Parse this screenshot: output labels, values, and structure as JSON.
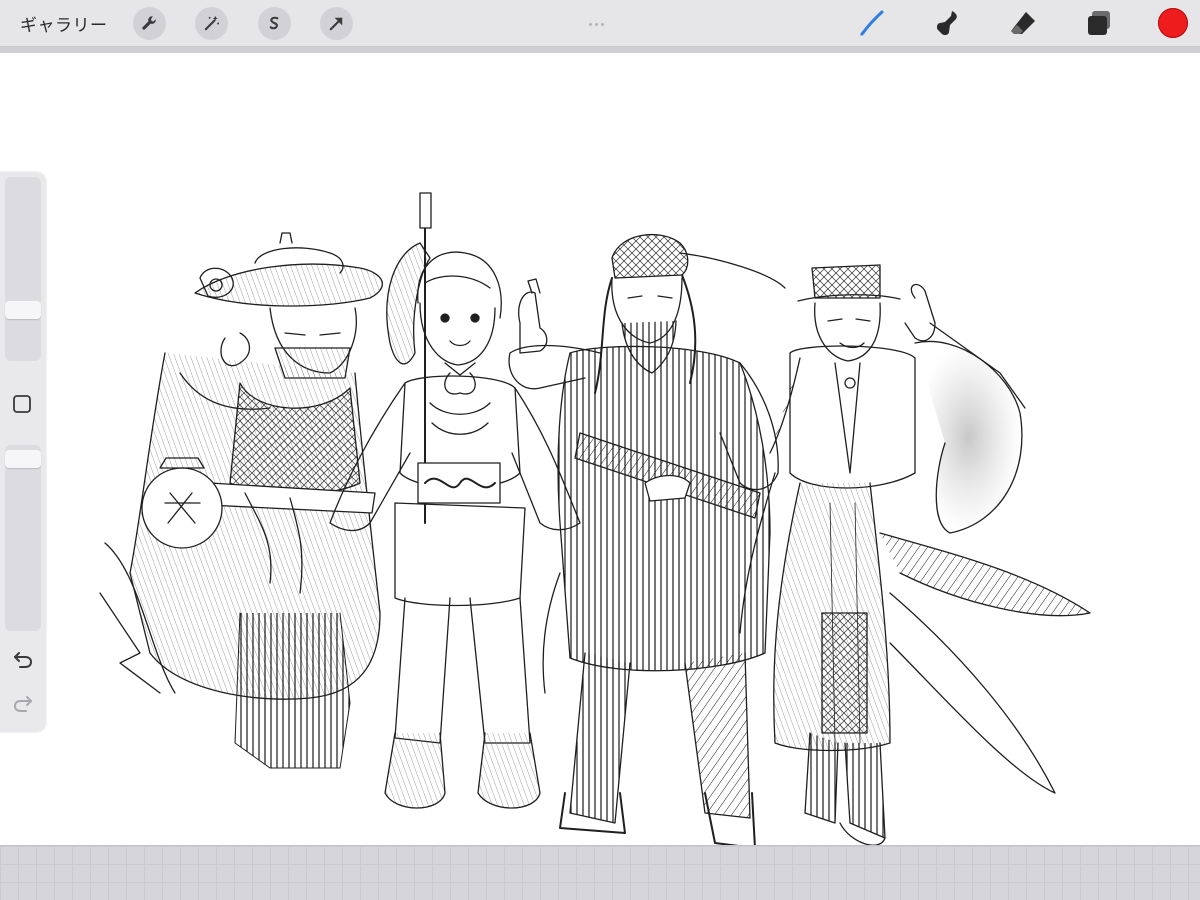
{
  "topbar": {
    "gallery_label": "ギャラリー",
    "left_tools": [
      "wrench-icon",
      "magic-wand-icon",
      "selection-icon",
      "transform-arrow-icon"
    ],
    "right_tools": [
      "brush-icon",
      "smudge-icon",
      "eraser-icon",
      "layers-icon"
    ],
    "active_tool": "brush-icon",
    "current_color": "#ee1c1c"
  },
  "sidebar": {
    "controls": [
      "brush-size-slider",
      "modify-button",
      "opacity-slider",
      "undo-icon",
      "redo-icon"
    ],
    "brush_size_level": 0.18,
    "opacity_level": 0.05
  },
  "canvas": {
    "background": "#ffffff",
    "content": "pencil-sketch"
  },
  "colors": {
    "toolbar_bg": "#e6e6e8",
    "accent_brush": "#2f7fe0",
    "ink": "#1a1a1a"
  }
}
